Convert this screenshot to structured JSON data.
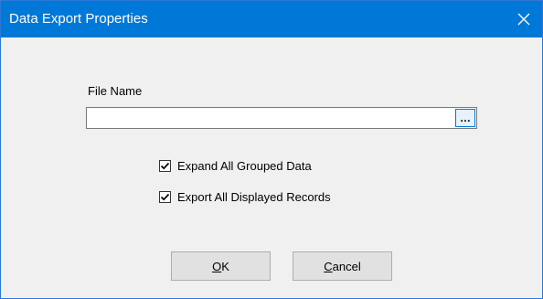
{
  "window": {
    "title": "Data Export Properties"
  },
  "form": {
    "file_name_label": "File Name",
    "file_name_value": "",
    "browse_label": "…",
    "options": [
      {
        "label": "Expand All Grouped Data",
        "checked": true
      },
      {
        "label": "Export All Displayed Records",
        "checked": true
      }
    ]
  },
  "buttons": {
    "ok_mnemonic": "O",
    "ok_rest": "K",
    "cancel_mnemonic": "C",
    "cancel_rest": "ancel"
  },
  "icons": {
    "close": "close-icon",
    "checkmark": "checkmark-icon",
    "browse": "ellipsis-icon"
  },
  "colors": {
    "titlebar": "#0078d7",
    "background": "#f0f0f0",
    "button_face": "#e1e1e1"
  }
}
